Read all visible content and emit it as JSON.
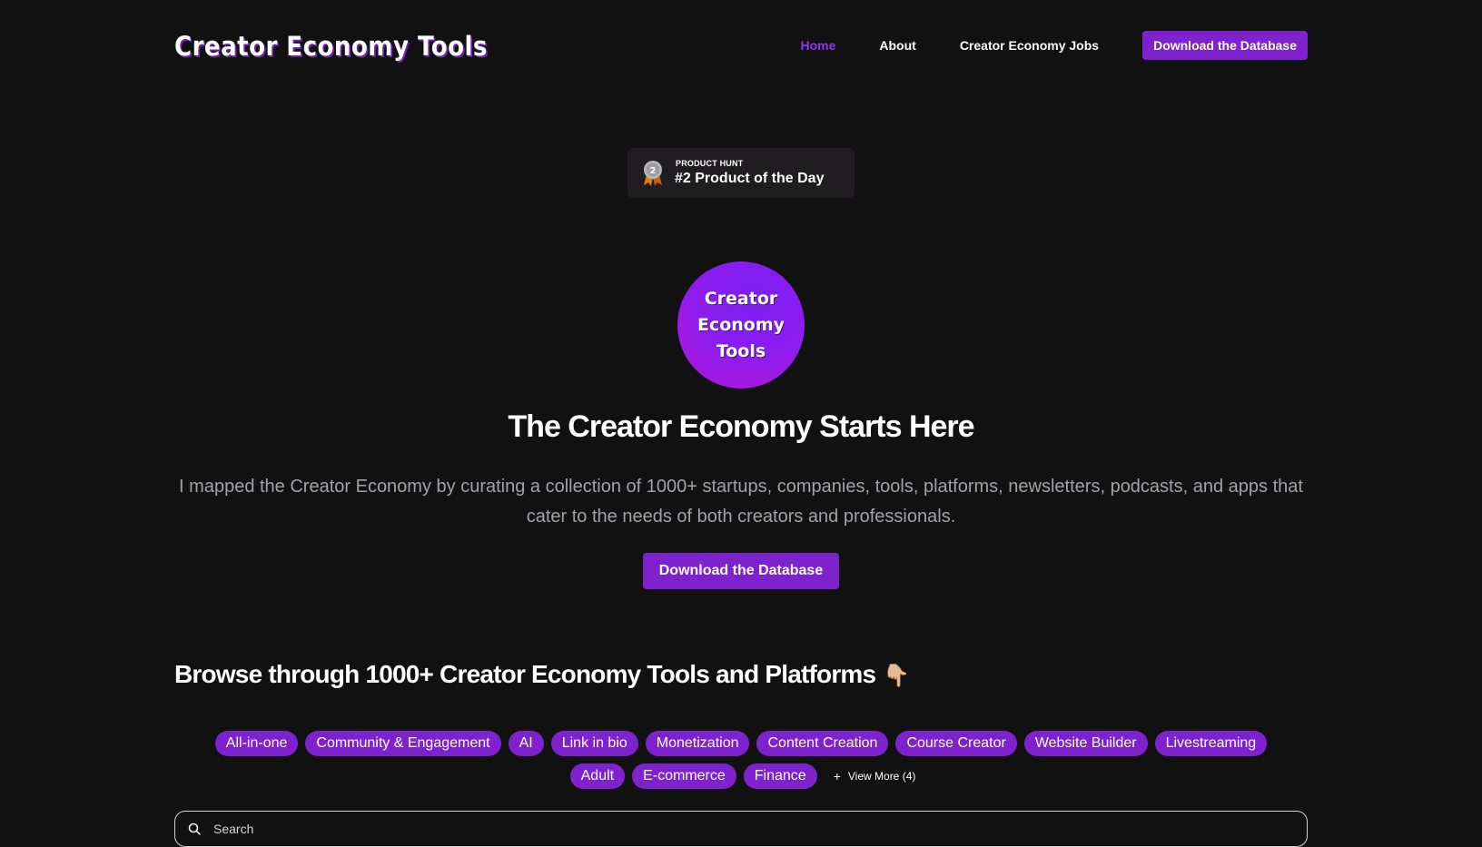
{
  "nav": {
    "logo_text": "Creator Economy Tools",
    "links": [
      "Home",
      "About",
      "Creator Economy Jobs"
    ],
    "active_link": "Home",
    "cta_label": "Download the Database"
  },
  "product_hunt_badge": {
    "medal_number": "2",
    "small_label": "PRODUCT HUNT",
    "main_label": "#2 Product of the Day"
  },
  "hero": {
    "logo_lines": [
      "Creator",
      "Economy",
      "Tools"
    ],
    "title": "The Creator Economy Starts Here",
    "description": "I mapped the Creator Economy by curating a collection of 1000+ startups, companies, tools, platforms, newsletters, podcasts, and apps that cater to the needs of both creators and professionals.",
    "cta_label": "Download the Database"
  },
  "browse": {
    "title": "Browse through 1000+ Creator Economy Tools and Platforms",
    "emoji": "👇🏼",
    "tags_row1": [
      "All-in-one",
      "Community & Engagement",
      "AI",
      "Link in bio",
      "Monetization",
      "Content Creation",
      "Course Creator",
      "Website Builder",
      "Livestreaming"
    ],
    "tags_row2": [
      "Adult",
      "E-commerce",
      "Finance"
    ],
    "view_more_label": "View More (4)"
  },
  "search": {
    "placeholder": "Search"
  },
  "colors": {
    "background": "#111111",
    "accent": "#7e22ce",
    "active_link": "#9333ea",
    "muted_text": "#a1a1aa"
  }
}
